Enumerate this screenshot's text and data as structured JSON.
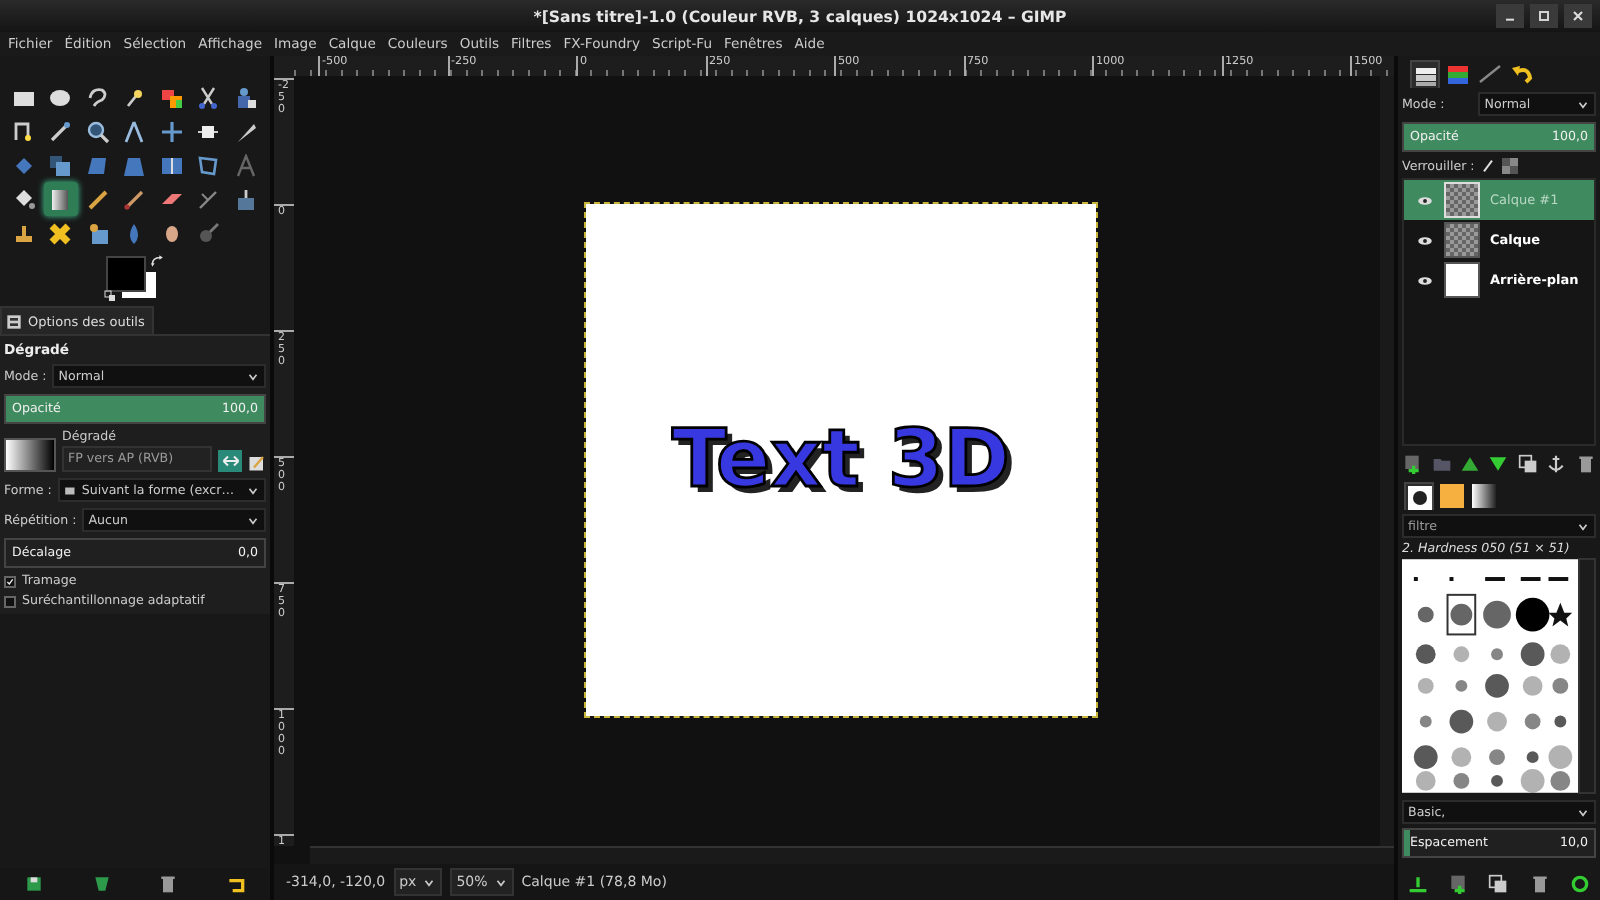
{
  "window": {
    "title": "*[Sans titre]-1.0 (Couleur RVB, 3 calques) 1024x1024 – GIMP"
  },
  "menu": [
    "Fichier",
    "Édition",
    "Sélection",
    "Affichage",
    "Image",
    "Calque",
    "Couleurs",
    "Outils",
    "Filtres",
    "FX-Foundry",
    "Script-Fu",
    "Fenêtres",
    "Aide"
  ],
  "toolbox": {
    "tools": [
      {
        "selected": false
      },
      {
        "selected": false
      },
      {
        "selected": false
      },
      {
        "selected": false
      },
      {
        "selected": false
      },
      {
        "selected": false
      },
      {
        "selected": false
      },
      {
        "selected": false
      },
      {
        "selected": false
      },
      {
        "selected": false
      },
      {
        "selected": false
      },
      {
        "selected": false
      },
      {
        "selected": false
      },
      {
        "selected": false
      },
      {
        "selected": false
      },
      {
        "selected": false
      },
      {
        "selected": false
      },
      {
        "selected": false
      },
      {
        "selected": false
      },
      {
        "selected": false
      },
      {
        "selected": false
      },
      {
        "selected": false
      },
      {
        "selected": true
      },
      {
        "selected": false
      },
      {
        "selected": false
      },
      {
        "selected": false
      },
      {
        "selected": false
      },
      {
        "selected": false
      },
      {
        "selected": false
      },
      {
        "selected": false
      },
      {
        "selected": false
      },
      {
        "selected": false
      },
      {
        "selected": false
      },
      {
        "selected": false
      }
    ]
  },
  "tool_options": {
    "tab": "Options des outils",
    "tool": "Dégradé",
    "mode": {
      "label": "Mode :",
      "value": "Normal"
    },
    "opacity": {
      "label": "Opacité",
      "value": "100,0",
      "level": 1
    },
    "gradient": {
      "label": "Dégradé",
      "value": "FP vers AP (RVB)"
    },
    "shape": {
      "label": "Forme :",
      "value": "Suivant la forme (excr…"
    },
    "repeat": {
      "label": "Répétition :",
      "value": "Aucun"
    },
    "offset": {
      "label": "Décalage",
      "value": "0,0"
    },
    "checkboxes": [
      {
        "label": "Tramage",
        "checked": true
      },
      {
        "label": "Suréchantillonnage adaptatif",
        "checked": false
      }
    ]
  },
  "canvas": {
    "top_ruler": [
      "-500",
      "-250",
      "0",
      "250",
      "500",
      "750",
      "1000",
      "1250",
      "1500"
    ],
    "left_ruler": [
      "-250",
      "0",
      "250",
      "500",
      "750",
      "1000",
      "1"
    ],
    "image_text": "Text 3D"
  },
  "status_bar": {
    "coords": "-314,0, -120,0",
    "unit": "px",
    "zoom": "50%",
    "message": "Calque #1 (78,8 Mo)"
  },
  "layers_panel": {
    "tabs": [
      {
        "selected": true
      },
      {
        "selected": false
      },
      {
        "selected": false
      },
      {
        "selected": false
      }
    ],
    "mode": {
      "label": "Mode :",
      "value": "Normal"
    },
    "opacity": {
      "label": "Opacité",
      "value": "100,0",
      "level": 1
    },
    "lock_label": "Verrouiller :",
    "layers": [
      {
        "name": "Calque #1",
        "selected": true
      },
      {
        "name": "Calque",
        "selected": false
      },
      {
        "name": "Arrière-plan",
        "selected": false
      }
    ]
  },
  "brushes_panel": {
    "tabs": [
      {
        "selected": true
      },
      {
        "selected": false
      },
      {
        "selected": false
      }
    ],
    "filter_placeholder": "filtre",
    "brush_name": "2. Hardness 050 (51 × 51)",
    "preset": "Basic,",
    "spacing": {
      "label": "Espacement",
      "value": "10,0",
      "level": 0.03
    }
  }
}
